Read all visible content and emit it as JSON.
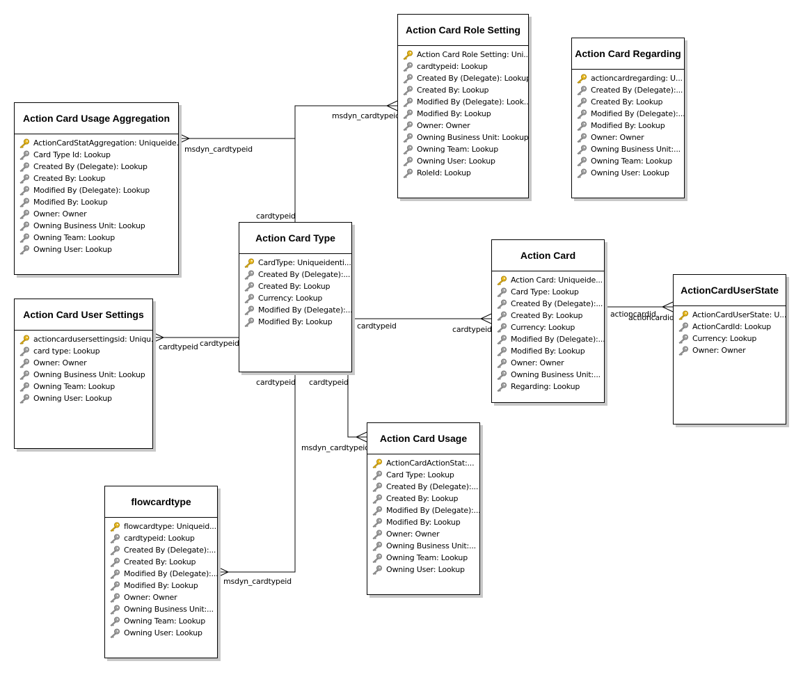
{
  "diagram": {
    "entities": [
      {
        "id": "action-card-role-setting",
        "title": "Action Card Role Setting",
        "fields": [
          {
            "text": "Action Card Role Setting: Uni...",
            "kind": "primary"
          },
          {
            "text": "cardtypeid: Lookup",
            "kind": "lookup"
          },
          {
            "text": "Created By (Delegate): Lookup",
            "kind": "lookup"
          },
          {
            "text": "Created By: Lookup",
            "kind": "lookup"
          },
          {
            "text": "Modified By (Delegate): Look...",
            "kind": "lookup"
          },
          {
            "text": "Modified By: Lookup",
            "kind": "lookup"
          },
          {
            "text": "Owner: Owner",
            "kind": "lookup"
          },
          {
            "text": "Owning Business Unit: Lookup",
            "kind": "lookup"
          },
          {
            "text": "Owning Team: Lookup",
            "kind": "lookup"
          },
          {
            "text": "Owning User: Lookup",
            "kind": "lookup"
          },
          {
            "text": "RoleId: Lookup",
            "kind": "lookup"
          }
        ]
      },
      {
        "id": "action-card-regarding",
        "title": "Action Card Regarding",
        "fields": [
          {
            "text": "actioncardregarding: U...",
            "kind": "primary"
          },
          {
            "text": "Created By (Delegate):...",
            "kind": "lookup"
          },
          {
            "text": "Created By: Lookup",
            "kind": "lookup"
          },
          {
            "text": "Modified By (Delegate):...",
            "kind": "lookup"
          },
          {
            "text": "Modified By: Lookup",
            "kind": "lookup"
          },
          {
            "text": "Owner: Owner",
            "kind": "lookup"
          },
          {
            "text": "Owning Business Unit:...",
            "kind": "lookup"
          },
          {
            "text": "Owning Team: Lookup",
            "kind": "lookup"
          },
          {
            "text": "Owning User: Lookup",
            "kind": "lookup"
          }
        ]
      },
      {
        "id": "action-card-usage-aggregation",
        "title": "Action Card Usage Aggregation",
        "fields": [
          {
            "text": "ActionCardStatAggregation: Uniqueide...",
            "kind": "primary"
          },
          {
            "text": "Card Type Id: Lookup",
            "kind": "lookup"
          },
          {
            "text": "Created By (Delegate): Lookup",
            "kind": "lookup"
          },
          {
            "text": "Created By: Lookup",
            "kind": "lookup"
          },
          {
            "text": "Modified By (Delegate): Lookup",
            "kind": "lookup"
          },
          {
            "text": "Modified By: Lookup",
            "kind": "lookup"
          },
          {
            "text": "Owner: Owner",
            "kind": "lookup"
          },
          {
            "text": "Owning Business Unit: Lookup",
            "kind": "lookup"
          },
          {
            "text": "Owning Team: Lookup",
            "kind": "lookup"
          },
          {
            "text": "Owning User: Lookup",
            "kind": "lookup"
          }
        ]
      },
      {
        "id": "action-card-type",
        "title": "Action Card Type",
        "fields": [
          {
            "text": "CardType: Uniqueidenti...",
            "kind": "primary"
          },
          {
            "text": "Created By (Delegate):...",
            "kind": "lookup"
          },
          {
            "text": "Created By: Lookup",
            "kind": "lookup"
          },
          {
            "text": "Currency: Lookup",
            "kind": "lookup"
          },
          {
            "text": "Modified By (Delegate):...",
            "kind": "lookup"
          },
          {
            "text": "Modified By: Lookup",
            "kind": "lookup"
          }
        ]
      },
      {
        "id": "action-card",
        "title": "Action Card",
        "fields": [
          {
            "text": "Action Card: Uniqueide...",
            "kind": "primary"
          },
          {
            "text": "Card Type: Lookup",
            "kind": "lookup"
          },
          {
            "text": "Created By (Delegate):...",
            "kind": "lookup"
          },
          {
            "text": "Created By: Lookup",
            "kind": "lookup"
          },
          {
            "text": "Currency: Lookup",
            "kind": "lookup"
          },
          {
            "text": "Modified By (Delegate):...",
            "kind": "lookup"
          },
          {
            "text": "Modified By: Lookup",
            "kind": "lookup"
          },
          {
            "text": "Owner: Owner",
            "kind": "lookup"
          },
          {
            "text": "Owning Business Unit:...",
            "kind": "lookup"
          },
          {
            "text": "Regarding: Lookup",
            "kind": "lookup"
          }
        ]
      },
      {
        "id": "action-card-user-state",
        "title": "ActionCardUserState",
        "fields": [
          {
            "text": "ActionCardUserState: U...",
            "kind": "primary"
          },
          {
            "text": "ActionCardId: Lookup",
            "kind": "lookup"
          },
          {
            "text": "Currency: Lookup",
            "kind": "lookup"
          },
          {
            "text": "Owner: Owner",
            "kind": "lookup"
          }
        ]
      },
      {
        "id": "action-card-user-settings",
        "title": "Action Card User Settings",
        "fields": [
          {
            "text": "actioncardusersettingsid: Uniqu...",
            "kind": "primary"
          },
          {
            "text": "card type: Lookup",
            "kind": "lookup"
          },
          {
            "text": "Owner: Owner",
            "kind": "lookup"
          },
          {
            "text": "Owning Business Unit: Lookup",
            "kind": "lookup"
          },
          {
            "text": "Owning Team: Lookup",
            "kind": "lookup"
          },
          {
            "text": "Owning User: Lookup",
            "kind": "lookup"
          }
        ]
      },
      {
        "id": "action-card-usage",
        "title": "Action Card Usage",
        "fields": [
          {
            "text": "ActionCardActionStat:...",
            "kind": "primary"
          },
          {
            "text": "Card Type: Lookup",
            "kind": "lookup"
          },
          {
            "text": "Created By (Delegate):...",
            "kind": "lookup"
          },
          {
            "text": "Created By: Lookup",
            "kind": "lookup"
          },
          {
            "text": "Modified By (Delegate):...",
            "kind": "lookup"
          },
          {
            "text": "Modified By: Lookup",
            "kind": "lookup"
          },
          {
            "text": "Owner: Owner",
            "kind": "lookup"
          },
          {
            "text": "Owning Business Unit:...",
            "kind": "lookup"
          },
          {
            "text": "Owning Team: Lookup",
            "kind": "lookup"
          },
          {
            "text": "Owning User: Lookup",
            "kind": "lookup"
          }
        ]
      },
      {
        "id": "flowcardtype",
        "title": "flowcardtype",
        "fields": [
          {
            "text": "flowcardtype: Uniqueid...",
            "kind": "primary"
          },
          {
            "text": "cardtypeid: Lookup",
            "kind": "lookup"
          },
          {
            "text": "Created By (Delegate):...",
            "kind": "lookup"
          },
          {
            "text": "Created By: Lookup",
            "kind": "lookup"
          },
          {
            "text": "Modified By (Delegate):...",
            "kind": "lookup"
          },
          {
            "text": "Modified By: Lookup",
            "kind": "lookup"
          },
          {
            "text": "Owner: Owner",
            "kind": "lookup"
          },
          {
            "text": "Owning Business Unit:...",
            "kind": "lookup"
          },
          {
            "text": "Owning Team: Lookup",
            "kind": "lookup"
          },
          {
            "text": "Owning User: Lookup",
            "kind": "lookup"
          }
        ]
      }
    ],
    "relationships": [
      {
        "from": "action-card-type",
        "to": "action-card-role-setting",
        "from_label": "cardtypeid",
        "to_label": "msdyn_cardtypeid"
      },
      {
        "from": "action-card-type",
        "to": "action-card-usage-aggregation",
        "from_label": "cardtypeid",
        "to_label": "msdyn_cardtypeid"
      },
      {
        "from": "action-card-type",
        "to": "action-card-user-settings",
        "from_label": "cardtypeid",
        "to_label": "cardtypeid"
      },
      {
        "from": "action-card-type",
        "to": "action-card",
        "from_label": "cardtypeid",
        "to_label": "cardtypeid"
      },
      {
        "from": "action-card-type",
        "to": "action-card-usage",
        "from_label": "cardtypeid",
        "to_label": "msdyn_cardtypeid"
      },
      {
        "from": "action-card-type",
        "to": "flowcardtype",
        "from_label": "cardtypeid",
        "to_label": "msdyn_cardtypeid"
      },
      {
        "from": "action-card",
        "to": "action-card-user-state",
        "from_label": "actioncardid",
        "to_label": "actioncardid"
      }
    ],
    "icons": {
      "primary": "primary-key-icon",
      "lookup": "foreign-key-icon"
    },
    "colors": {
      "primary_key": "#e8b820",
      "lookup_key": "#a0a0a0",
      "line": "#000000",
      "shadow": "#c8c8c8"
    }
  }
}
